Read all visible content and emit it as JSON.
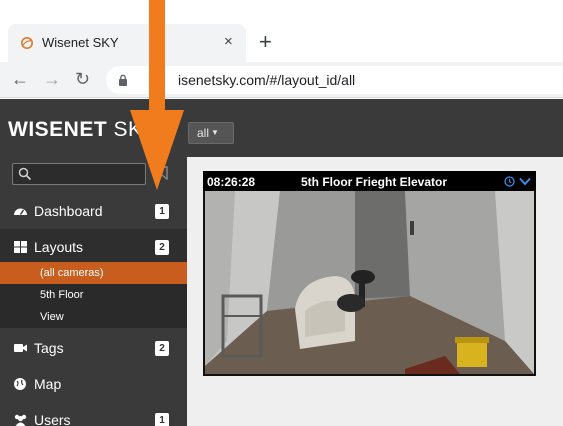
{
  "browser": {
    "tab_title": "Wisenet SKY",
    "tab_close": "×",
    "new_tab": "+",
    "url": "isenetsky.com/#/layout_id/all",
    "back": "←",
    "forward": "→",
    "reload": "↻"
  },
  "app": {
    "brand_main": "WISENET",
    "brand_sky": " SKY",
    "layout_select": "all",
    "search_placeholder": "",
    "nav": [
      {
        "label": "Dashboard",
        "badge": "1",
        "icon": "dashboard-icon"
      },
      {
        "label": "Layouts",
        "badge": "2",
        "icon": "layouts-icon"
      },
      {
        "label": "Tags",
        "badge": "2",
        "icon": "tags-icon"
      },
      {
        "label": "Map",
        "badge": "",
        "icon": "map-icon"
      },
      {
        "label": "Users",
        "badge": "1",
        "icon": "users-icon"
      }
    ],
    "layouts_sub": [
      {
        "label": "(all cameras)"
      },
      {
        "label": "5th Floor"
      },
      {
        "label": "View"
      }
    ]
  },
  "camera": {
    "time": "08:26:28",
    "title": "5th Floor Frieght Elevator"
  },
  "colors": {
    "sidebar_bg": "#3a3a3a",
    "selected_accent": "#c85d1e",
    "annotation_arrow": "#f07c1e",
    "camera_icon_blue": "#3b8eea"
  }
}
